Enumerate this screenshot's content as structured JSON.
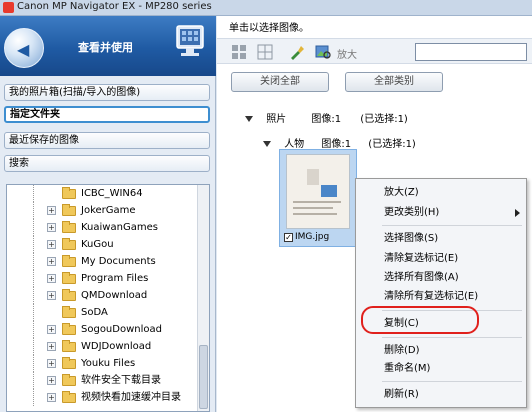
{
  "window": {
    "title": "Canon MP Navigator EX - MP280 series"
  },
  "banner": {
    "label": "查看并使用"
  },
  "nav": [
    {
      "label": "我的照片箱(扫描/导入的图像)"
    },
    {
      "label": "指定文件夹"
    },
    {
      "label": "最近保存的图像"
    },
    {
      "label": "搜索"
    }
  ],
  "tree": [
    {
      "label": "ICBC_WIN64",
      "expandable": false
    },
    {
      "label": "JokerGame",
      "expandable": true
    },
    {
      "label": "KuaiwanGames",
      "expandable": true
    },
    {
      "label": "KuGou",
      "expandable": true
    },
    {
      "label": "My Documents",
      "expandable": true
    },
    {
      "label": "Program Files",
      "expandable": true
    },
    {
      "label": "QMDownload",
      "expandable": true
    },
    {
      "label": "SoDA",
      "expandable": false
    },
    {
      "label": "SogouDownload",
      "expandable": true
    },
    {
      "label": "WDJDownload",
      "expandable": true
    },
    {
      "label": "Youku Files",
      "expandable": true
    },
    {
      "label": "软件安全下载目录",
      "expandable": true
    },
    {
      "label": "视频快看加速缓冲目录",
      "expandable": true
    }
  ],
  "main": {
    "instruction": "单击以选择图像。",
    "toolbar": {
      "zoom_label": "放大"
    },
    "buttons": {
      "close_all": "关闭全部",
      "all_categories": "全部类别"
    },
    "group": {
      "name": "照片",
      "images": "图像:1",
      "selected": "(已选择:1)"
    },
    "subgroup": {
      "name": "人物",
      "images": "图像:1",
      "selected": "(已选择:1)"
    },
    "thumbnail": {
      "filename": "IMG.jpg",
      "checked": true
    }
  },
  "context_menu": {
    "items": [
      {
        "label": "放大(Z)"
      },
      {
        "label": "更改类别(H)",
        "submenu": true
      },
      {
        "label": "选择图像(S)"
      },
      {
        "label": "清除复选标记(E)"
      },
      {
        "label": "选择所有图像(A)"
      },
      {
        "label": "清除所有复选标记(E)"
      },
      {
        "label": "复制(C)",
        "highlighted": true
      },
      {
        "label": "删除(D)"
      },
      {
        "label": "重命名(M)"
      },
      {
        "label": "刷新(R)"
      }
    ]
  },
  "colors": {
    "highlight_ring": "#e0201c",
    "banner": "#1f5aa3",
    "selection": "#bcd6f1"
  }
}
